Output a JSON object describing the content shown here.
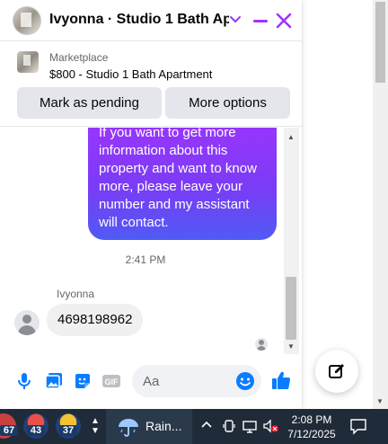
{
  "header": {
    "title": "Ivyonna · Studio 1 Bath Ap...",
    "accent": "#a033ff"
  },
  "listing": {
    "source": "Marketplace",
    "name": "$800 - Studio 1 Bath Apartment",
    "pending_label": "Mark as pending",
    "more_label": "More options"
  },
  "messages": {
    "outgoing_text": "If you want to get more information about this property and want to know more, please leave your number and my assistant will contact.",
    "timestamp": "2:41 PM",
    "sender_name": "Ivyonna",
    "incoming_text": "4698198962"
  },
  "composer": {
    "placeholder": "Aa",
    "icons": [
      "microphone-icon",
      "photo-icon",
      "sticker-icon",
      "gif-icon",
      "emoji-icon",
      "like-icon"
    ]
  },
  "taskbar": {
    "apps": [
      {
        "name": "weather-app-1",
        "badge": "67"
      },
      {
        "name": "weather-app-2",
        "badge": "43"
      },
      {
        "name": "weather-app-3",
        "badge": "37"
      }
    ],
    "weather_label": "Rain...",
    "time": "2:08 PM",
    "date": "7/12/2025"
  }
}
